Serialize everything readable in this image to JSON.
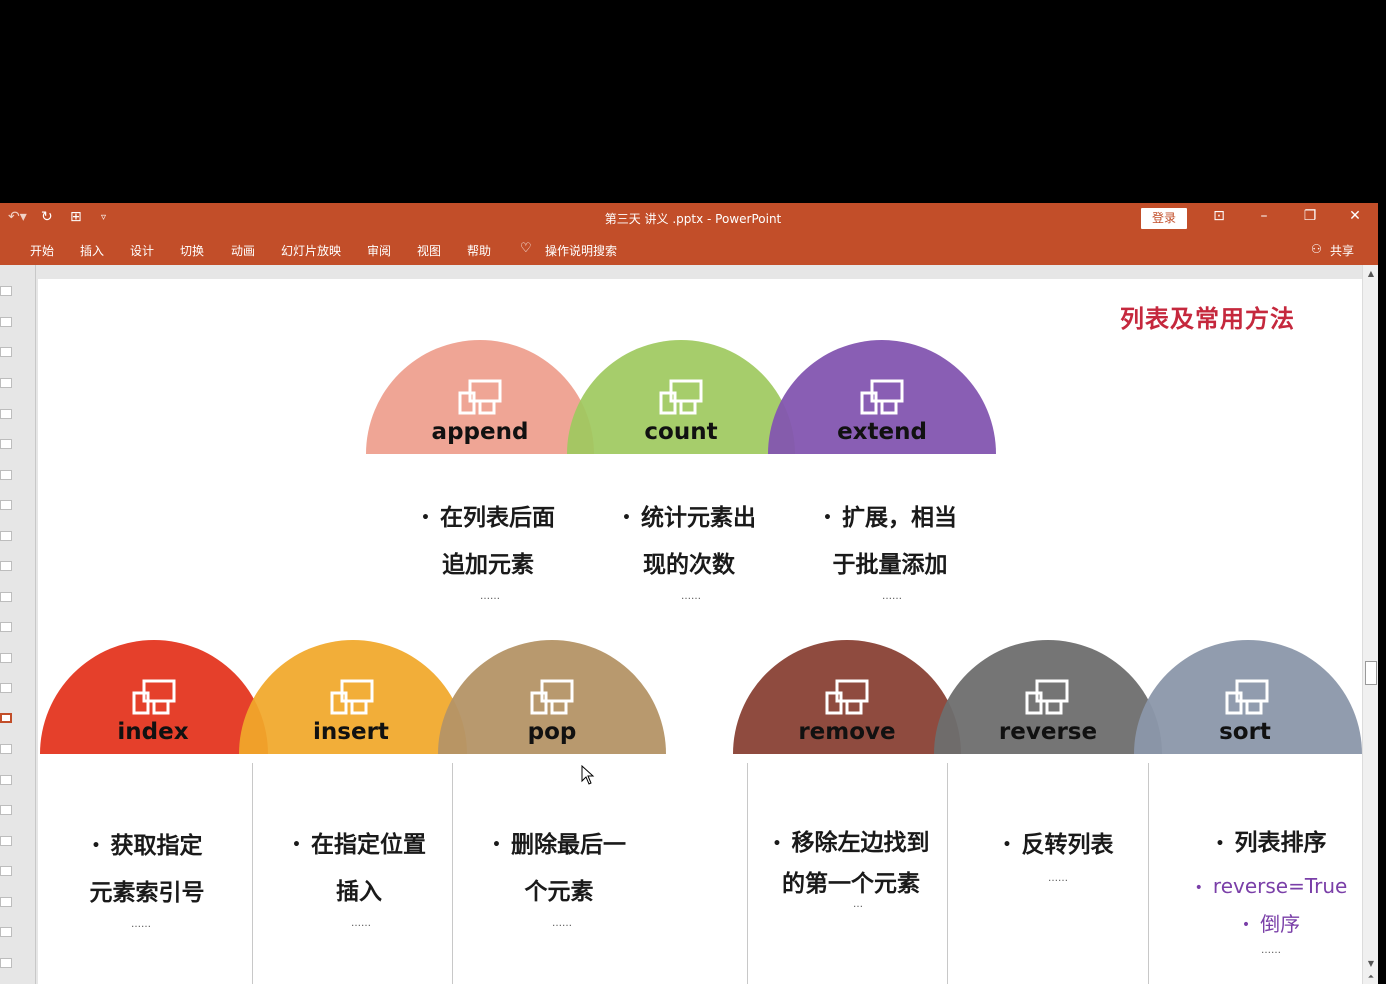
{
  "window": {
    "title": "第三天 讲义 .pptx  -  PowerPoint",
    "login_label": "登录",
    "share_label": "共享"
  },
  "ribbon": {
    "tabs": [
      "开始",
      "插入",
      "设计",
      "切换",
      "动画",
      "幻灯片放映",
      "审阅",
      "视图",
      "帮助"
    ],
    "tell_me": "操作说明搜索"
  },
  "slide": {
    "title": "列表及常用方法",
    "top_methods": [
      {
        "name": "append",
        "color": "#eea08f",
        "desc_line1": "在列表后面",
        "desc_line2": "追加元素",
        "dots": "……"
      },
      {
        "name": "count",
        "color": "#9ec95e",
        "desc_line1": "统计元素出",
        "desc_line2": "现的次数",
        "dots": "……"
      },
      {
        "name": "extend",
        "color": "#8355b0",
        "desc_line1": "扩展，相当",
        "desc_line2": "于批量添加",
        "dots": "……"
      }
    ],
    "bottom_methods": [
      {
        "name": "index",
        "color": "#e43a24",
        "desc_line1": "获取指定",
        "desc_line2": "元素索引号",
        "dots": "……"
      },
      {
        "name": "insert",
        "color": "#f1a82a",
        "desc_line1": "在指定位置",
        "desc_line2": "插入",
        "dots": "……"
      },
      {
        "name": "pop",
        "color": "#b49466",
        "desc_line1": "删除最后一",
        "desc_line2": "个元素",
        "dots": "……"
      },
      {
        "name": "remove",
        "color": "#8b4539",
        "desc_line1": "移除左边找到",
        "desc_line2": "的第一个元素",
        "dots": "…"
      },
      {
        "name": "reverse",
        "color": "#6e6e6e",
        "desc_line1": "反转列表",
        "desc_line2": "",
        "dots": "……"
      },
      {
        "name": "sort",
        "color": "#8b97aa",
        "desc_line1": "列表排序",
        "desc_line2": "reverse=True",
        "desc_line3": "倒序",
        "dots": "……"
      }
    ]
  },
  "icons": {
    "undo": "undo-icon",
    "redo": "redo-icon",
    "slideshow": "start-slideshow-icon",
    "customize": "customize-qat-icon",
    "tell_me": "lightbulb-icon",
    "share": "person-icon",
    "method": "devices-icon"
  }
}
